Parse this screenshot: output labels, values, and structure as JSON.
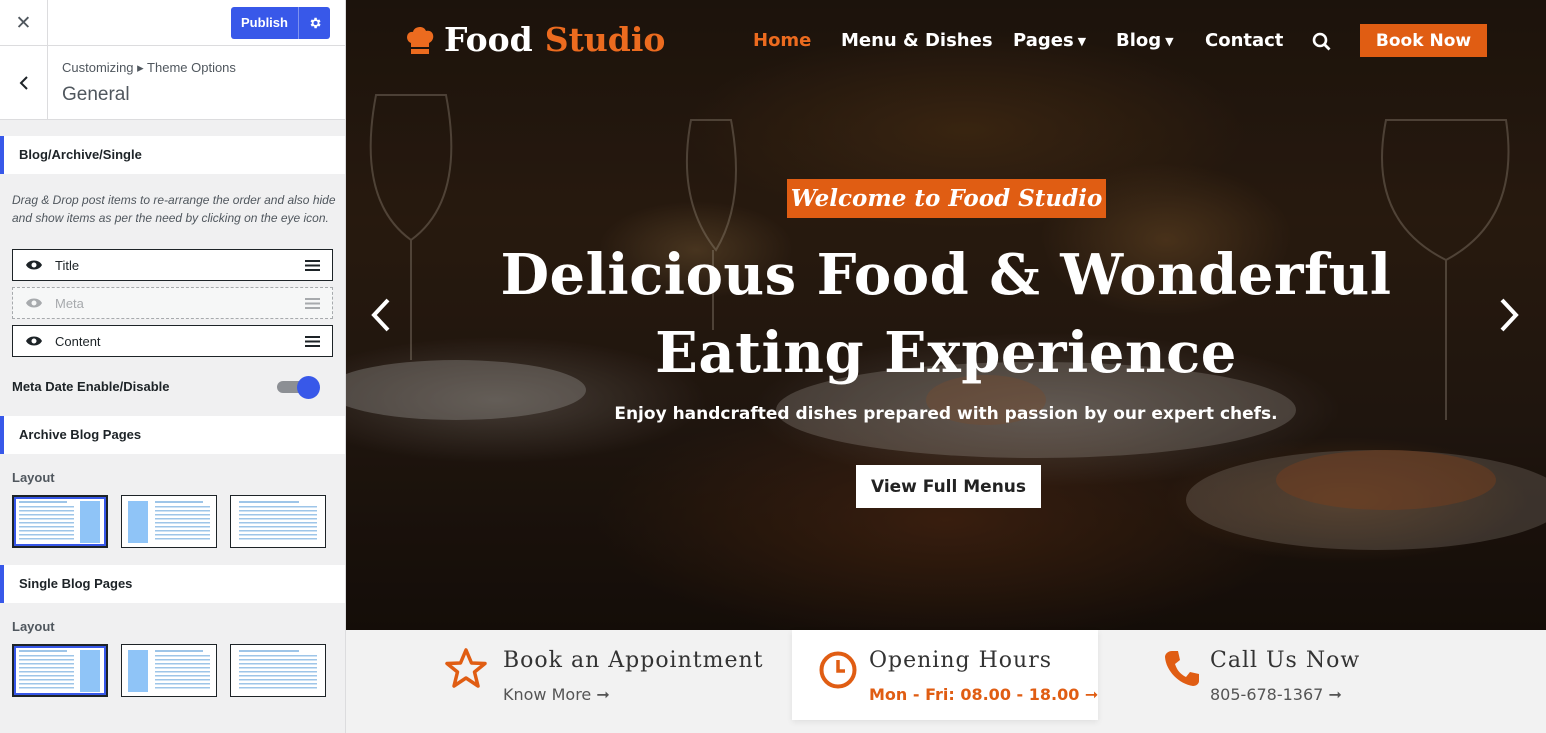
{
  "customizer": {
    "close_icon": "close-icon",
    "publish_label": "Publish",
    "breadcrumb": "Customizing ▸ Theme Options",
    "section_title": "General",
    "blog_section": {
      "heading": "Blog/Archive/Single",
      "description": "Drag & Drop post items to re-arrange the order and also hide and show items as per the need by clicking on the eye icon.",
      "items": [
        {
          "label": "Title",
          "visible": true
        },
        {
          "label": "Meta",
          "visible": false
        },
        {
          "label": "Content",
          "visible": true
        }
      ],
      "meta_date_label": "Meta Date Enable/Disable",
      "meta_date_enabled": true
    },
    "archive_section": {
      "heading": "Archive Blog Pages",
      "layout_label": "Layout",
      "selected_layout": 0
    },
    "single_section": {
      "heading": "Single Blog Pages",
      "layout_label": "Layout",
      "selected_layout": 0
    },
    "accent_color": "#3858e9"
  },
  "site": {
    "logo_word1": "Food",
    "logo_word2": "Studio",
    "nav": [
      {
        "label": "Home",
        "active": true
      },
      {
        "label": "Menu & Dishes",
        "active": false
      },
      {
        "label": "Pages",
        "active": false,
        "dropdown": true
      },
      {
        "label": "Blog",
        "active": false,
        "dropdown": true
      },
      {
        "label": "Contact",
        "active": false
      }
    ],
    "book_button": "Book Now",
    "hero": {
      "badge": "Welcome to Food Studio",
      "headline_line1": "Delicious Food & Wonderful",
      "headline_line2": "Eating Experience",
      "subheadline": "Enjoy handcrafted dishes prepared with passion by our expert chefs.",
      "cta": "View Full Menus"
    },
    "info": [
      {
        "icon": "star-icon",
        "title": "Book an Appointment",
        "link": "Know More"
      },
      {
        "icon": "clock-icon",
        "title": "Opening Hours",
        "link": "Mon - Fri: 08.00 - 18.00"
      },
      {
        "icon": "phone-icon",
        "title": "Call Us Now",
        "link": "805-678-1367"
      }
    ],
    "accent_color": "#e05d13"
  }
}
